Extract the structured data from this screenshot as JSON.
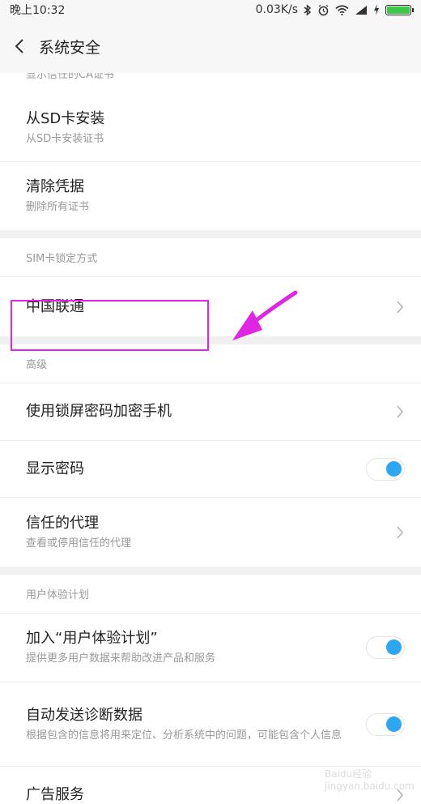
{
  "status_bar": {
    "time": "晚上10:32",
    "network_speed": "0.03K/s"
  },
  "header": {
    "title": "系统安全"
  },
  "partial_row": "显示信任的CA证书",
  "sections": [
    {
      "items": [
        {
          "title": "从SD卡安装",
          "subtitle": "从SD卡安装证书"
        },
        {
          "title": "清除凭据",
          "subtitle": "删除所有证书"
        }
      ]
    },
    {
      "header": "SIM卡锁定方式",
      "items": [
        {
          "title": "中国联通",
          "control": "chevron"
        }
      ]
    },
    {
      "header": "高级",
      "items": [
        {
          "title": "使用锁屏密码加密手机",
          "control": "chevron"
        },
        {
          "title": "显示密码",
          "control": "toggle",
          "toggle_on": true
        },
        {
          "title": "信任的代理",
          "subtitle": "查看或停用信任的代理",
          "control": "chevron"
        }
      ]
    },
    {
      "header": "用户体验计划",
      "items": [
        {
          "title": "加入“用户体验计划”",
          "subtitle": "提供更多用户数据来帮助改进产品和服务",
          "control": "toggle",
          "toggle_on": true
        },
        {
          "title": "自动发送诊断数据",
          "subtitle": "根据包含的信息将用来定位、分析系统中的问题，可能包含个人信息",
          "control": "toggle",
          "toggle_on": true
        },
        {
          "title": "广告服务",
          "control": "chevron"
        }
      ]
    }
  ],
  "colors": {
    "accent": "#2da6f3",
    "highlight": "#e025e5",
    "battery": "#3ec84a"
  },
  "watermark": "Baidu经验 jingyan.baidu.com"
}
